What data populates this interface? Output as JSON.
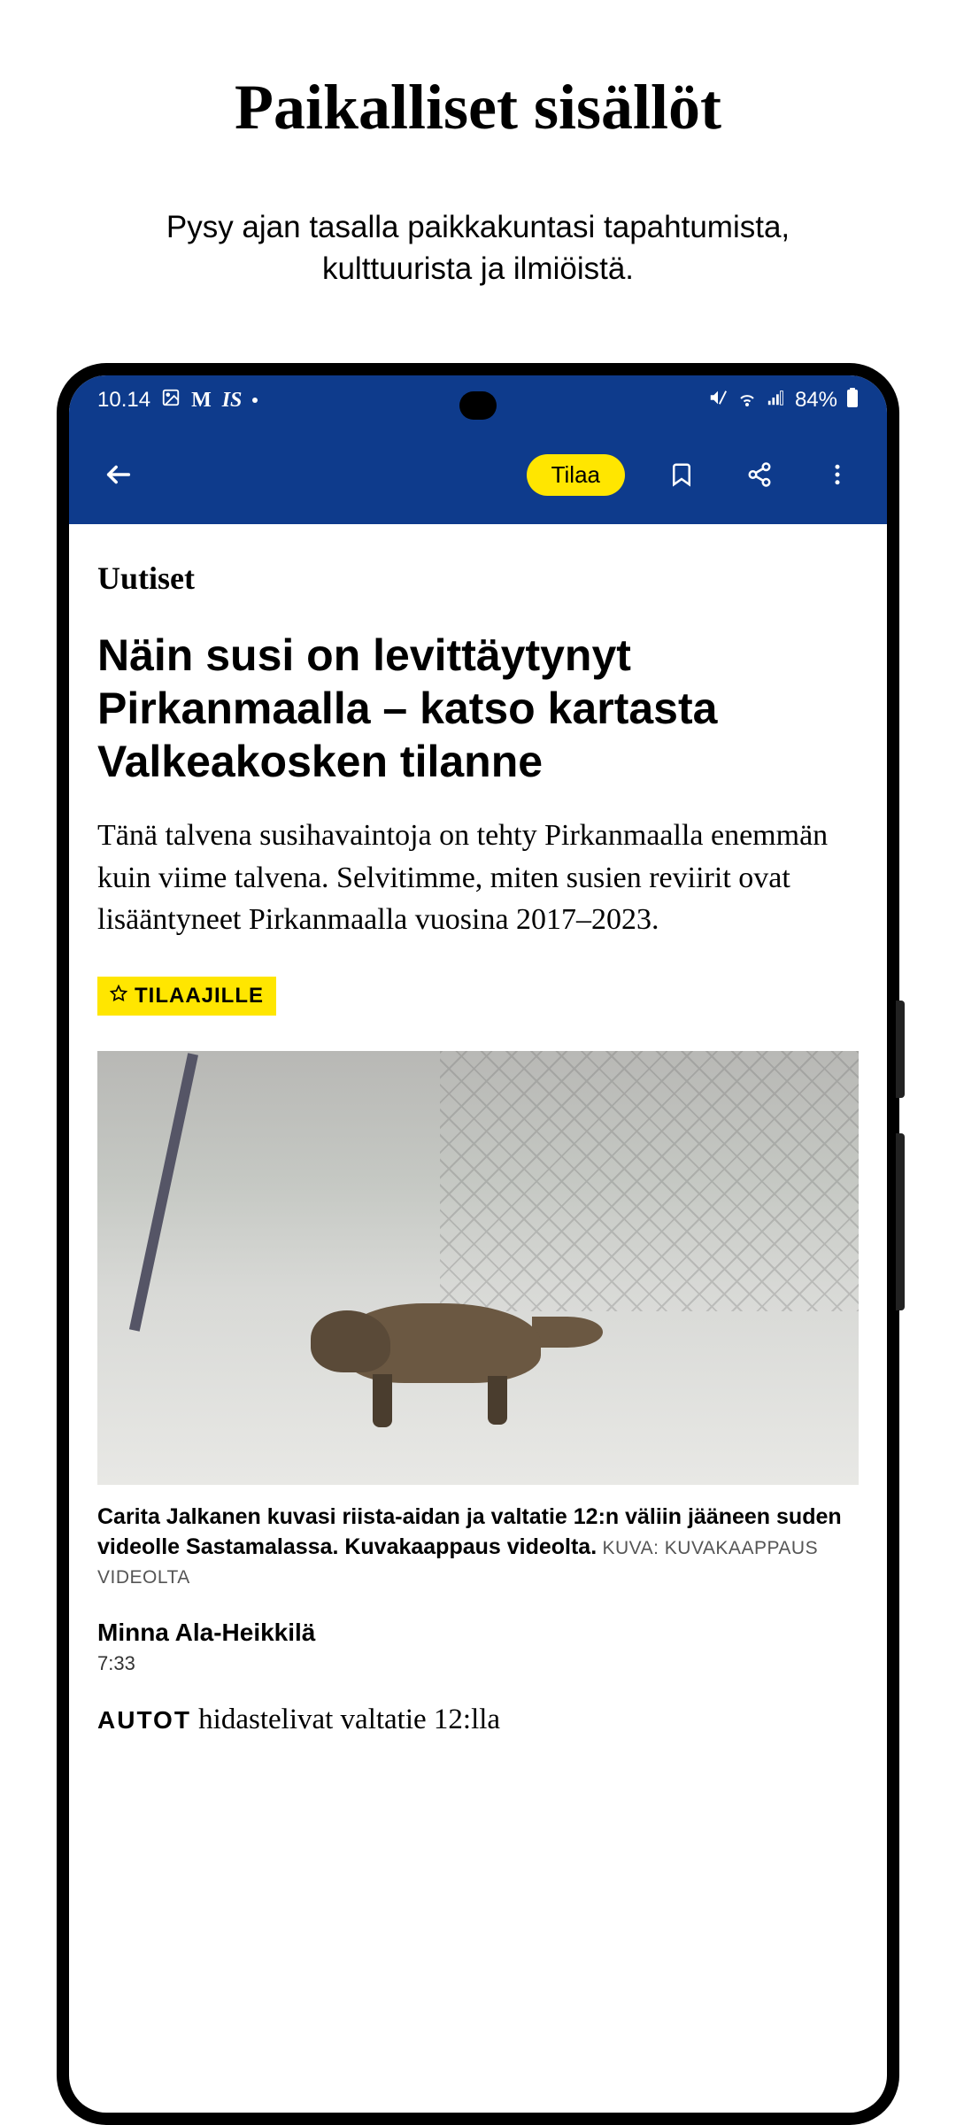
{
  "marketing": {
    "title": "Paikalliset sisällöt",
    "subtitle": "Pysy ajan tasalla paikkakuntasi tapahtumista, kulttuurista ja ilmiöistä."
  },
  "status": {
    "time": "10.14",
    "gmail": "M",
    "is": "IS",
    "battery": "84%"
  },
  "appbar": {
    "tilaa": "Tilaa"
  },
  "article": {
    "category": "Uutiset",
    "headline": "Näin susi on levittäytynyt Pirkanmaalla – katso kartasta Valkeakosken tilanne",
    "lead": "Tänä talvena susihavaintoja on tehty Pirkanmaalla enemmän kuin viime talvena. Selvitimme, miten susien reviirit ovat lisääntyneet Pirkanmaalla vuosina 2017–2023.",
    "subscriber_badge": "TILAAJILLE",
    "caption_bold": "Carita Jalkanen kuvasi riista-aidan ja valtatie 12:n väliin jääneen suden videolle Sastamalassa. Kuvakaappaus videolta.",
    "caption_source": " KUVA: KUVAKAAPPAUS VIDEOLTA",
    "author": "Minna Ala-Heikkilä",
    "timestamp": "7:33",
    "body_kicker": "AUTOT",
    "body_start": " hidastelivat valtatie 12:lla"
  }
}
